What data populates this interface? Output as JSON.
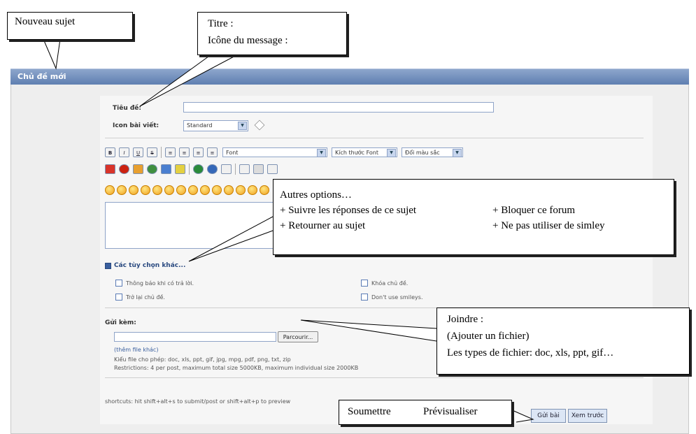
{
  "window": {
    "title": "Chủ đề mới"
  },
  "form": {
    "subject_label": "Tiêu đề:",
    "subject_value": "",
    "icon_label": "Icon bài viết:",
    "icon_value": "Standard",
    "font_select": "Font",
    "size_select": "Kích thước Font",
    "color_select": "Đổi màu sắc",
    "toolbar_buttons": [
      "B",
      "I",
      "U",
      "S",
      "≡",
      "≡",
      "≡",
      "≡"
    ],
    "other_options_label": "Các tùy chọn khác...",
    "options": {
      "notify": "Thông báo khi có trả lời.",
      "return_topic": "Trở lại chủ đề.",
      "lock_topic": "Khóa chủ đề.",
      "no_smileys": "Don't use smileys."
    },
    "attach_label": "Gửi kèm:",
    "browse_button": "Parcourir...",
    "add_file_link": "(thêm file khác)",
    "allowed_types": "Kiểu file cho phép: doc, xls, ppt, gif, jpg, mpg, pdf, png, txt, zip",
    "restrictions": "Restrictions: 4 per post, maximum total size 5000KB, maximum individual size 2000KB",
    "shortcuts": "shortcuts: hit shift+alt+s to submit/post or shift+alt+p to preview",
    "submit_button": "Gửi bài",
    "preview_button": "Xem trước"
  },
  "callouts": {
    "new_topic": "Nouveau sujet",
    "title_line1": "Titre :",
    "title_line2": "Icône du message :",
    "options_line1": "Autres options…",
    "options_a": "+ Suivre les réponses de ce sujet",
    "options_b": "+ Bloquer ce forum",
    "options_c": "+ Retourner au sujet",
    "options_d": "+ Ne pas utiliser de simley",
    "attach_line1": "Joindre :",
    "attach_line2": "(Ajouter un fichier)",
    "attach_line3": "Les types de fichier: doc, xls, ppt, gif…",
    "submit_fr": "Soumettre",
    "preview_fr": "Prévisualiser"
  }
}
